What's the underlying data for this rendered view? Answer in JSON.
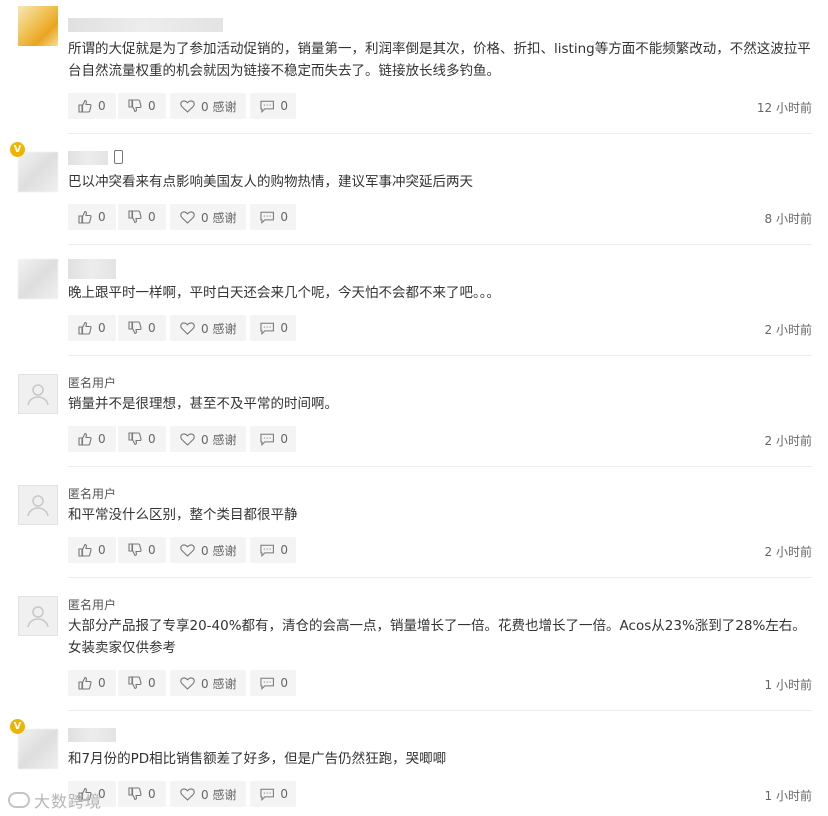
{
  "comments": [
    {
      "user": "",
      "avatar": "color",
      "vip": false,
      "text": "所谓的大促就是为了参加活动促销的，销量第一，利润率倒是其次，价格、折扣、listing等方面不能频繁改动，不然这波拉平台自然流量权重的机会就因为链接不稳定而失去了。链接放长线多钓鱼。",
      "up": "0",
      "down": "0",
      "thanks": "0 感谢",
      "reply": "0",
      "time": "12 小时前"
    },
    {
      "user": "",
      "avatar": "blur",
      "vip": true,
      "device": true,
      "text": "巴以冲突看来有点影响美国友人的购物热情，建议军事冲突延后两天",
      "up": "0",
      "down": "0",
      "thanks": "0 感谢",
      "reply": "0",
      "time": "8 小时前"
    },
    {
      "user": "",
      "avatar": "blur",
      "vip": false,
      "text": "晚上跟平时一样啊，平时白天还会来几个呢，今天怕不会都不来了吧。。。",
      "up": "0",
      "down": "0",
      "thanks": "0 感谢",
      "reply": "0",
      "time": "2 小时前"
    },
    {
      "user": "匿名用户",
      "avatar": "anon",
      "vip": false,
      "text": "销量并不是很理想，甚至不及平常的时间啊。",
      "up": "0",
      "down": "0",
      "thanks": "0 感谢",
      "reply": "0",
      "time": "2 小时前"
    },
    {
      "user": "匿名用户",
      "avatar": "anon",
      "vip": false,
      "text": "和平常没什么区别，整个类目都很平静",
      "up": "0",
      "down": "0",
      "thanks": "0 感谢",
      "reply": "0",
      "time": "2 小时前"
    },
    {
      "user": "匿名用户",
      "avatar": "anon",
      "vip": false,
      "text": "大部分产品报了专享20-40%都有，清仓的会高一点，销量增长了一倍。花费也增长了一倍。Acos从23%涨到了28%左右。女装卖家仅供参考",
      "up": "0",
      "down": "0",
      "thanks": "0 感谢",
      "reply": "0",
      "time": "1 小时前"
    },
    {
      "user": "",
      "avatar": "blur",
      "vip": true,
      "text": "和7月份的PD相比销售额差了好多，但是广告仍然狂跑，哭唧唧",
      "up": "0",
      "down": "0",
      "thanks": "0 感谢",
      "reply": "0",
      "time": "1 小时前"
    }
  ],
  "vip_badge": "V",
  "watermark": "大数跨境",
  "icons": {
    "up": "thumbs-up-icon",
    "down": "thumbs-down-icon",
    "thanks": "heart-icon",
    "reply": "comment-icon",
    "device": "mobile-phone-icon",
    "anon": "user-silhouette-icon"
  }
}
